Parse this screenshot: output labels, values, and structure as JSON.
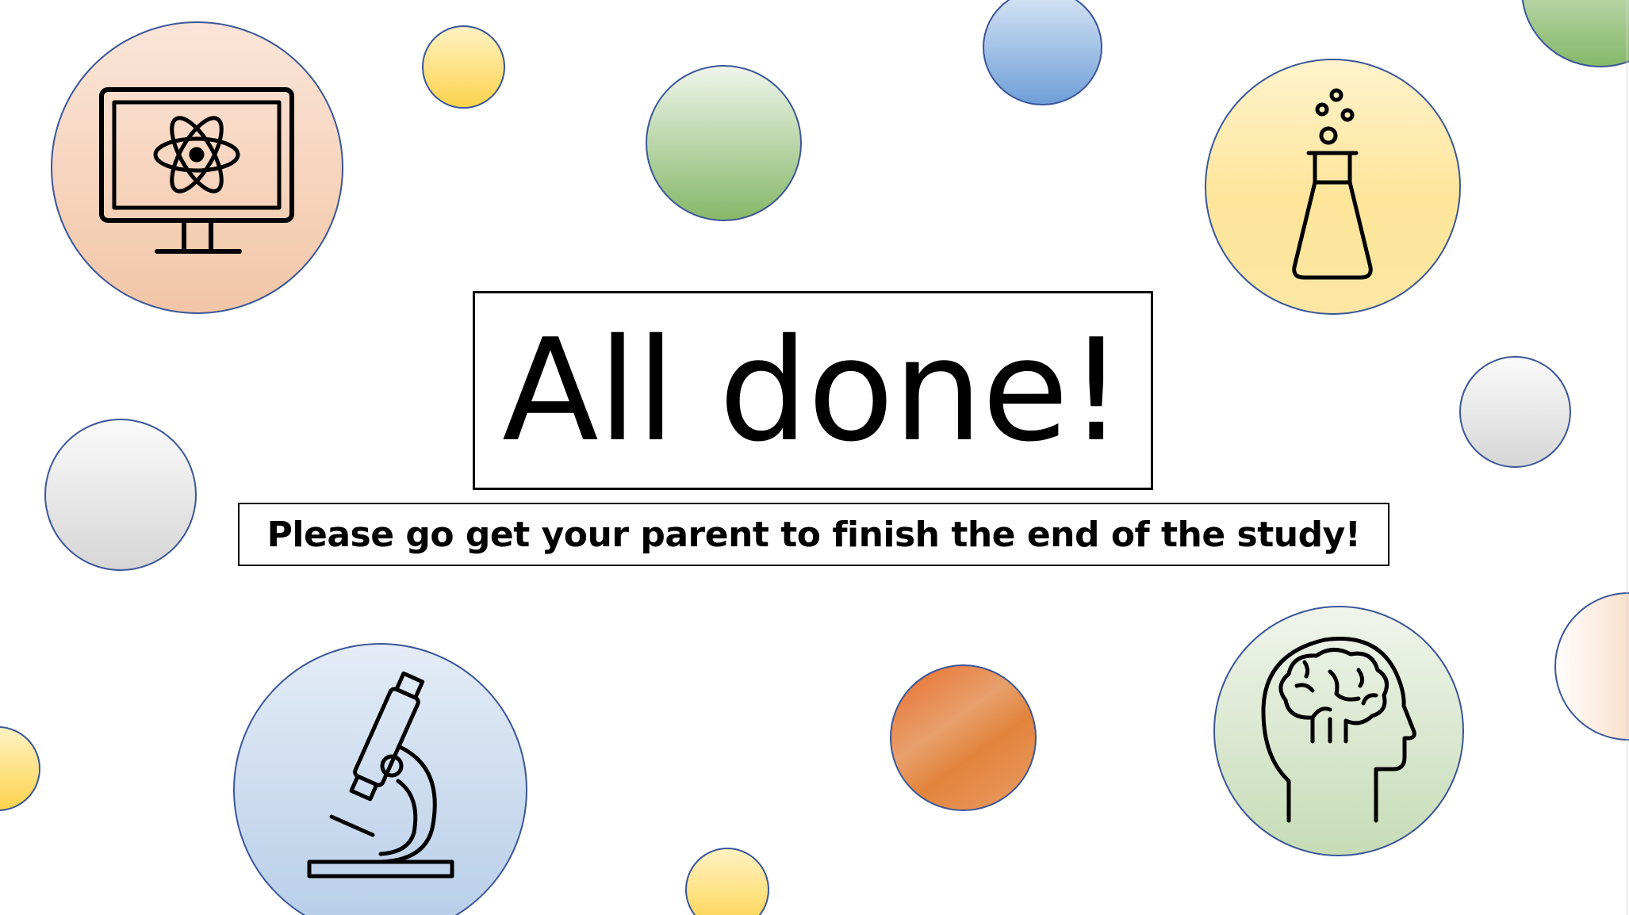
{
  "slide": {
    "title": "All done!",
    "message": "Please go get your parent to finish the end of the study!"
  },
  "icons": {
    "computer": "computer-atom-icon",
    "flask": "flask-icon",
    "microscope": "microscope-icon",
    "brain": "brain-head-icon"
  },
  "colors": {
    "bubble_border": "#3b5698",
    "orange": "#f2c6a7",
    "yellow": "#fde59a",
    "blue": "#b6cde8",
    "green": "#c6dcb6",
    "gray": "#d6d6d6",
    "text": "#000000"
  }
}
